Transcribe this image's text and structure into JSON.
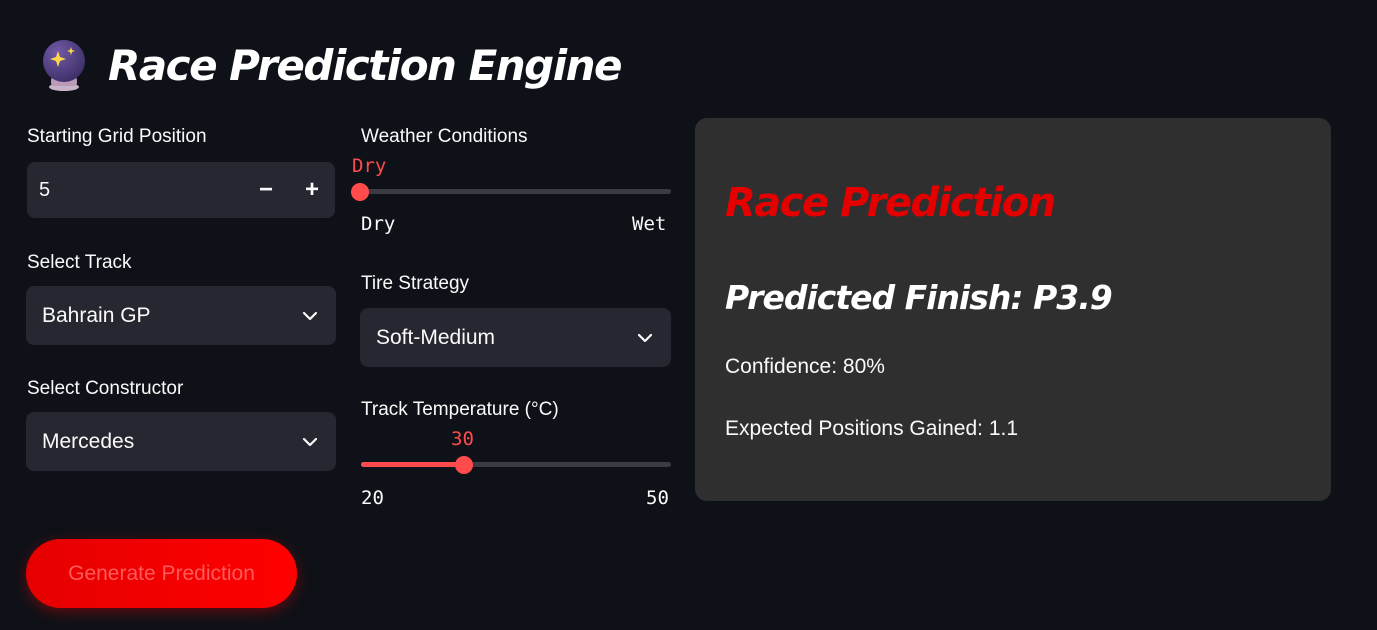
{
  "header": {
    "title": "Race Prediction Engine",
    "icon": "crystal-ball-icon"
  },
  "grid_position": {
    "label": "Starting Grid Position",
    "value": "5",
    "decrement": "−",
    "increment": "+"
  },
  "track": {
    "label": "Select Track",
    "value": "Bahrain GP"
  },
  "constructor": {
    "label": "Select Constructor",
    "value": "Mercedes"
  },
  "weather": {
    "label": "Weather Conditions",
    "value": "Dry",
    "min": "Dry",
    "max": "Wet",
    "fraction": 0
  },
  "tire": {
    "label": "Tire Strategy",
    "value": "Soft-Medium"
  },
  "temperature": {
    "label": "Track Temperature (°C)",
    "value": "30",
    "min": "20",
    "max": "50",
    "fraction": 0.333
  },
  "generate_button": {
    "label": "Generate Prediction"
  },
  "result": {
    "title": "Race Prediction",
    "finish": "Predicted Finish: P3.9",
    "confidence": "Confidence: 80%",
    "gained": "Expected Positions Gained: 1.1"
  },
  "colors": {
    "accent": "#ff4b4b",
    "brand_red": "#e50000",
    "background": "#0e1117",
    "panel": "#2f2f2f",
    "input": "#262730"
  }
}
